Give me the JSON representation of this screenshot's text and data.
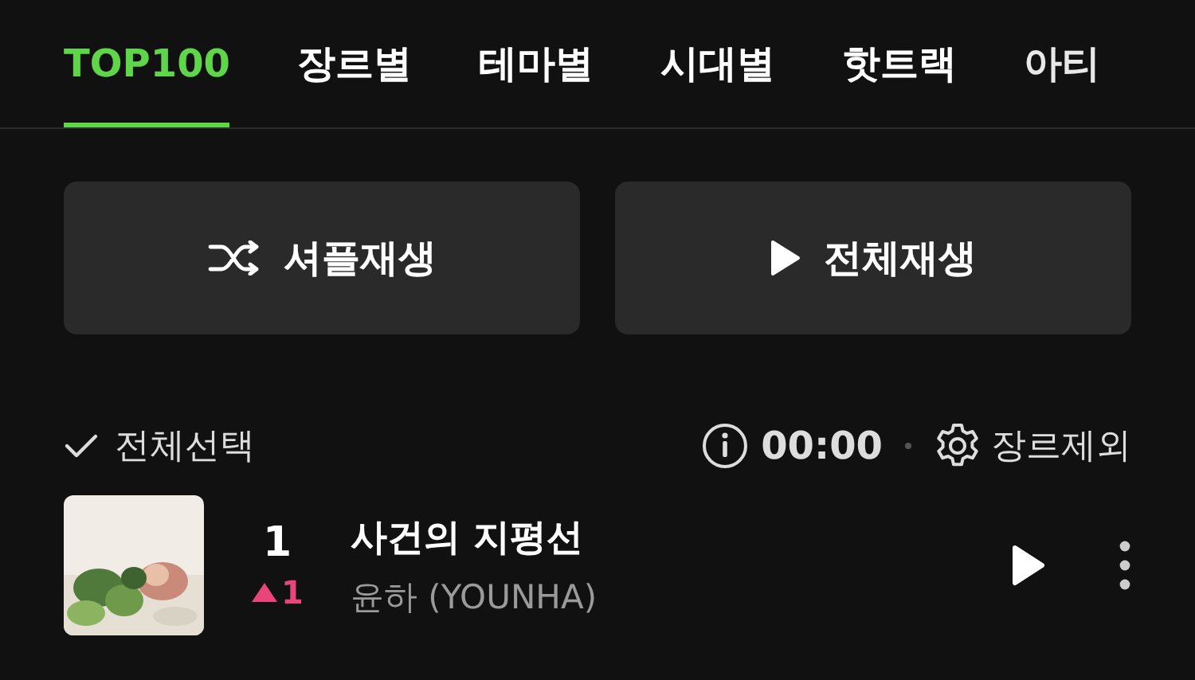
{
  "tabs": [
    {
      "label": "TOP100",
      "selected": true
    },
    {
      "label": "장르별",
      "selected": false
    },
    {
      "label": "테마별",
      "selected": false
    },
    {
      "label": "시대별",
      "selected": false
    },
    {
      "label": "핫트랙",
      "selected": false
    },
    {
      "label": "아티",
      "selected": false
    }
  ],
  "buttons": [
    {
      "kind": "shuffle",
      "label": "셔플재생"
    },
    {
      "kind": "play",
      "label": "전체재생"
    }
  ],
  "select_all": {
    "label": "전체선택"
  },
  "timer": {
    "time": "00:00"
  },
  "genre_exclude": {
    "label": "장르제외"
  },
  "songs": [
    {
      "rank": "1",
      "change": {
        "kind": "up",
        "value": "1"
      },
      "title": "사건의 지평선",
      "artist": "윤하 (YOUNHA)"
    }
  ]
}
